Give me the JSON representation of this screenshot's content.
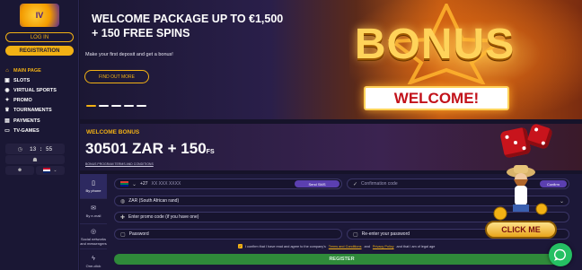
{
  "sidebar": {
    "logo_text": "IV",
    "login_label": "LOG IN",
    "registration_label": "REGISTRATION",
    "nav": [
      {
        "label": "MAIN PAGE",
        "icon": "home-icon"
      },
      {
        "label": "SLOTS",
        "icon": "slots-icon"
      },
      {
        "label": "VIRTUAL SPORTS",
        "icon": "virtual-sports-icon"
      },
      {
        "label": "PROMO",
        "icon": "promo-icon"
      },
      {
        "label": "TOURNAMENTS",
        "icon": "trophy-icon"
      },
      {
        "label": "PAYMENTS",
        "icon": "payments-icon"
      },
      {
        "label": "TV-GAMES",
        "icon": "tv-icon"
      }
    ],
    "clock": {
      "hours": "13",
      "minutes": "55"
    }
  },
  "hero": {
    "title": "WELCOME PACKAGE UP TO €1,500 + 150 FREE SPINS",
    "subtitle": "Make your first deposit and get a bonus!",
    "cta_label": "FIND OUT MORE",
    "bonus_word": "BONUS",
    "welcome_word": "WELCOME!"
  },
  "welcome_bonus": {
    "label": "WELCOME BONUS",
    "amount": "30501 ZAR + 150",
    "fs": "FS",
    "terms": "BONUS PROGRAM TERMS AND CONDITIONS"
  },
  "registration": {
    "tabs": [
      {
        "label": "By phone",
        "icon": "phone-icon"
      },
      {
        "label": "By e-mail",
        "icon": "email-icon"
      },
      {
        "label": "Social networks and messengers",
        "icon": "social-icon"
      },
      {
        "label": "One-click",
        "icon": "lightning-icon"
      }
    ],
    "phone_prefix": "+27",
    "phone_placeholder": "XX XXX XXXX",
    "send_sms_label": "Send SMS",
    "confirmation_placeholder": "Confirmation code",
    "confirm_label": "Confirm",
    "currency_value": "ZAR (South African rand)",
    "promo_placeholder": "Enter promo code (if you have one)",
    "password_placeholder": "Password",
    "repassword_placeholder": "Re-enter your password",
    "agree_prefix": "I confirm that I have read and agree to the company's",
    "terms_link": "Terms and Conditions",
    "and_text": "and",
    "privacy_link": "Privacy Policy",
    "agree_suffix": "and that I am of legal age",
    "register_label": "REGISTER"
  },
  "overlay": {
    "click_me_label": "CLICK ME"
  },
  "colors": {
    "accent": "#f2b114",
    "sidebar_bg": "#1a1734",
    "register_green": "#2f8a3a",
    "chat_green": "#25c063"
  }
}
